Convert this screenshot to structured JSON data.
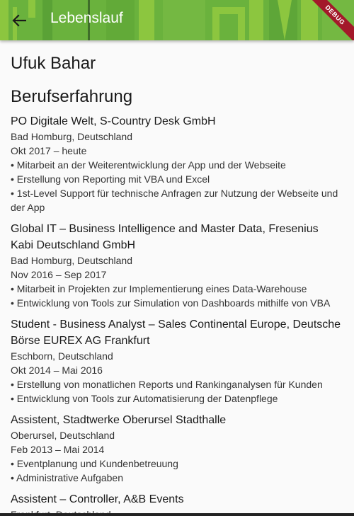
{
  "app_bar": {
    "title": "Lebenslauf",
    "debug_label": "DEBUG",
    "back_icon": "arrow-back-icon",
    "color": "#69b03c"
  },
  "profile": {
    "name": "Ufuk Bahar"
  },
  "section_title": "Berufserfahrung",
  "entries": [
    {
      "role": "PO Digitale Welt, S-Country Desk GmbH",
      "location": "Bad Homburg, Deutschland",
      "period": "Okt 2017 – heute",
      "bullets": [
        "• Mitarbeit an der Weiterentwicklung der App und der Webseite",
        "• Erstellung von Reporting mit VBA und Excel",
        "• 1st-Level Support für technische Anfragen zur Nutzung der Webseite und der App"
      ]
    },
    {
      "role": "Global IT – Business Intelligence and Master Data, Fresenius Kabi Deutschland GmbH",
      "location": "Bad Homburg, Deutschland",
      "period": "Nov 2016 – Sep 2017",
      "bullets": [
        "• Mitarbeit in Projekten zur Implementierung eines Data-Warehouse",
        "• Entwicklung von Tools zur Simulation von Dashboards mithilfe von VBA"
      ]
    },
    {
      "role": "Student - Business Analyst – Sales Continental Europe, Deutsche Börse EUREX AG Frankfurt",
      "location": "Eschborn, Deutschland",
      "period": "Okt 2014 – Mai 2016",
      "bullets": [
        "• Erstellung von monatlichen Reports und Rankinganalysen für Kunden",
        "• Entwicklung von Tools zur Automatisierung der Datenpflege"
      ]
    },
    {
      "role": "Assistent, Stadtwerke Oberursel Stadthalle",
      "location": "Oberursel, Deutschland",
      "period": "Feb 2013 – Mai 2014",
      "bullets": [
        "• Eventplanung und Kundenbetreuung",
        "• Administrative Aufgaben"
      ]
    },
    {
      "role": "Assistent – Controller, A&B Events",
      "location": "Frankfurt, Deutschland",
      "period": "",
      "bullets": []
    }
  ]
}
